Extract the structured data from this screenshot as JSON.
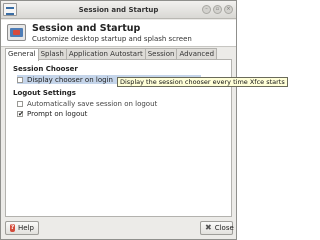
{
  "window": {
    "title": "Session and Startup",
    "controls": [
      "minimize",
      "maximize",
      "close"
    ]
  },
  "header": {
    "title": "Session and Startup",
    "subtitle": "Customize desktop startup and splash screen",
    "icon": "session-startup-icon"
  },
  "tabs": [
    {
      "label": "General",
      "active": true
    },
    {
      "label": "Splash",
      "active": false
    },
    {
      "label": "Application Autostart",
      "active": false
    },
    {
      "label": "Session",
      "active": false
    },
    {
      "label": "Advanced",
      "active": false
    }
  ],
  "general": {
    "session_chooser": {
      "title": "Session Chooser",
      "display_chooser_label": "Display chooser on login",
      "display_chooser_checked": false
    },
    "logout_settings": {
      "title": "Logout Settings",
      "auto_save_label": "Automatically save session on logout",
      "auto_save_checked": false,
      "prompt_label": "Prompt on logout",
      "prompt_checked": true
    }
  },
  "tooltip": "Display the session chooser every time Xfce starts",
  "buttons": {
    "help": "Help",
    "close": "Close"
  },
  "colors": {
    "highlight": "#c5d5ea",
    "tooltip_bg": "#ffffd8",
    "help_icon": "#d34a3a"
  }
}
